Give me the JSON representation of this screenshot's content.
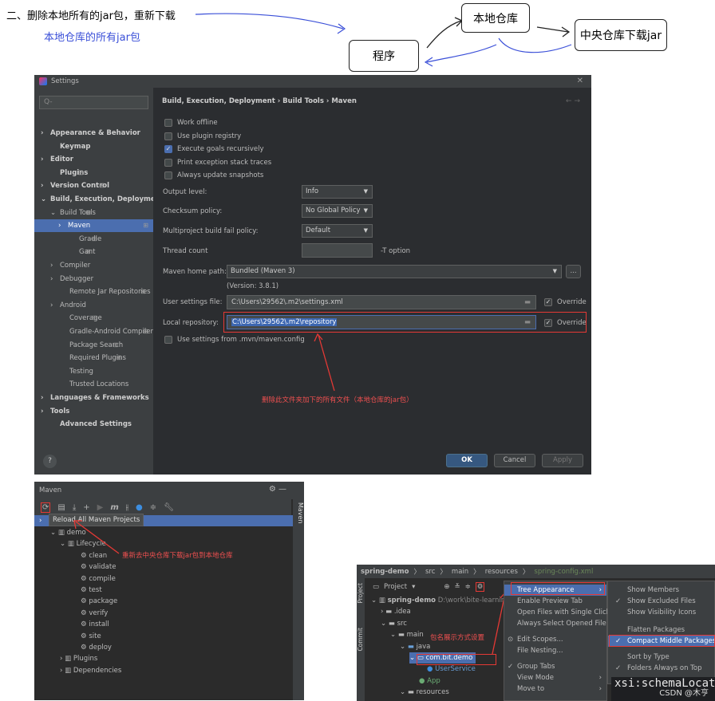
{
  "annotation": {
    "heading": "二、删除本地所有的jar包，重新下载",
    "subheading": "本地仓库的所有jar包",
    "local_repo_box": "本地仓库",
    "central_box": "中央仓库下载jar",
    "program_box": "程序"
  },
  "settings": {
    "window_title": "Settings",
    "search_placeholder": "Q-",
    "breadcrumb": "Build, Execution, Deployment  ›  Build Tools  ›  Maven",
    "sidebar": [
      {
        "label": "Appearance & Behavior",
        "chevron": "›"
      },
      {
        "label": "Keymap",
        "chevron": ""
      },
      {
        "label": "Editor",
        "chevron": "›"
      },
      {
        "label": "Plugins",
        "chevron": ""
      },
      {
        "label": "Version Control",
        "chevron": "›"
      },
      {
        "label": "Build, Execution, Deployment",
        "chevron": "⌄"
      },
      {
        "label": "Build Tools",
        "chevron": "⌄"
      },
      {
        "label": "Maven",
        "chevron": "›"
      },
      {
        "label": "Gradle",
        "chevron": ""
      },
      {
        "label": "Gant",
        "chevron": ""
      },
      {
        "label": "Compiler",
        "chevron": "›"
      },
      {
        "label": "Debugger",
        "chevron": "›"
      },
      {
        "label": "Remote Jar Repositories",
        "chevron": ""
      },
      {
        "label": "Android",
        "chevron": "›"
      },
      {
        "label": "Coverage",
        "chevron": ""
      },
      {
        "label": "Gradle-Android Compiler",
        "chevron": ""
      },
      {
        "label": "Package Search",
        "chevron": ""
      },
      {
        "label": "Required Plugins",
        "chevron": ""
      },
      {
        "label": "Testing",
        "chevron": ""
      },
      {
        "label": "Trusted Locations",
        "chevron": ""
      },
      {
        "label": "Languages & Frameworks",
        "chevron": "›"
      },
      {
        "label": "Tools",
        "chevron": "›"
      },
      {
        "label": "Advanced Settings",
        "chevron": ""
      }
    ],
    "options": {
      "work_offline": "Work offline",
      "use_plugin_registry": "Use plugin registry",
      "execute_goals_recursively": "Execute goals recursively",
      "print_exception_stack_traces": "Print exception stack traces",
      "always_update_snapshots": "Always update snapshots"
    },
    "output_level_label": "Output level:",
    "output_level_value": "Info",
    "checksum_policy_label": "Checksum policy:",
    "checksum_policy_value": "No Global Policy",
    "multiproject_label": "Multiproject build fail policy:",
    "multiproject_value": "Default",
    "thread_count_label": "Thread count",
    "thread_count_suffix": "-T option",
    "maven_home_label": "Maven home path:",
    "maven_home_value": "Bundled (Maven 3)",
    "maven_version": "(Version: 3.8.1)",
    "user_settings_label": "User settings file:",
    "user_settings_value": "C:\\Users\\29562\\.m2\\settings.xml",
    "local_repo_label": "Local repository:",
    "local_repo_value": "C:\\Users\\29562\\.m2\\repository",
    "override_label": "Override",
    "use_mvn_config": "Use settings from .mvn/maven.config",
    "annotation_red": "删除此文件夹加下的所有文件（本地仓库的jar包）",
    "ok": "OK",
    "cancel": "Cancel",
    "apply": "Apply",
    "help": "?",
    "browse": "...",
    "nav_arrows": "←  →"
  },
  "maven_panel": {
    "title": "Maven",
    "side_label": "Maven",
    "tooltip": "Reload All Maven Projects",
    "project": "demo",
    "lifecycle": "Lifecycle",
    "goals": [
      "clean",
      "validate",
      "compile",
      "test",
      "package",
      "verify",
      "install",
      "site",
      "deploy"
    ],
    "plugins": "Plugins",
    "dependencies": "Dependencies",
    "annotation_red": "重新去中央仓库下载jar包到本地仓库"
  },
  "project_panel": {
    "crumbs": [
      "spring-demo",
      "src",
      "main",
      "resources",
      "spring-config.xml"
    ],
    "header": "Project",
    "root": "spring-demo",
    "root_path": "D:\\work\\bite-learnin",
    "tree": [
      ".idea",
      "src",
      "main",
      "java",
      "com.bit.demo",
      "UserService",
      "App",
      "resources"
    ],
    "annotation_red": "包名展示方式设置",
    "menu": [
      "Tree Appearance",
      "Enable Preview Tab",
      "Open Files with Single Click",
      "Always Select Opened File",
      "Edit Scopes...",
      "File Nesting...",
      "Group Tabs",
      "View Mode",
      "Move to"
    ],
    "submenu": [
      "Show Members",
      "Show Excluded Files",
      "Show Visibility Icons",
      "Flatten Packages",
      "Compact Middle Packages",
      "Sort by Type",
      "Folders Always on Top"
    ],
    "code_text": "xsi:schemaLocat",
    "side_project": "Project",
    "side_commit": "Commit"
  },
  "watermark": "CSDN @木亨",
  "colors": {
    "accent_red": "#e53935",
    "selection_blue": "#4b6eaf",
    "annotation_blue": "#3a4fd8"
  }
}
